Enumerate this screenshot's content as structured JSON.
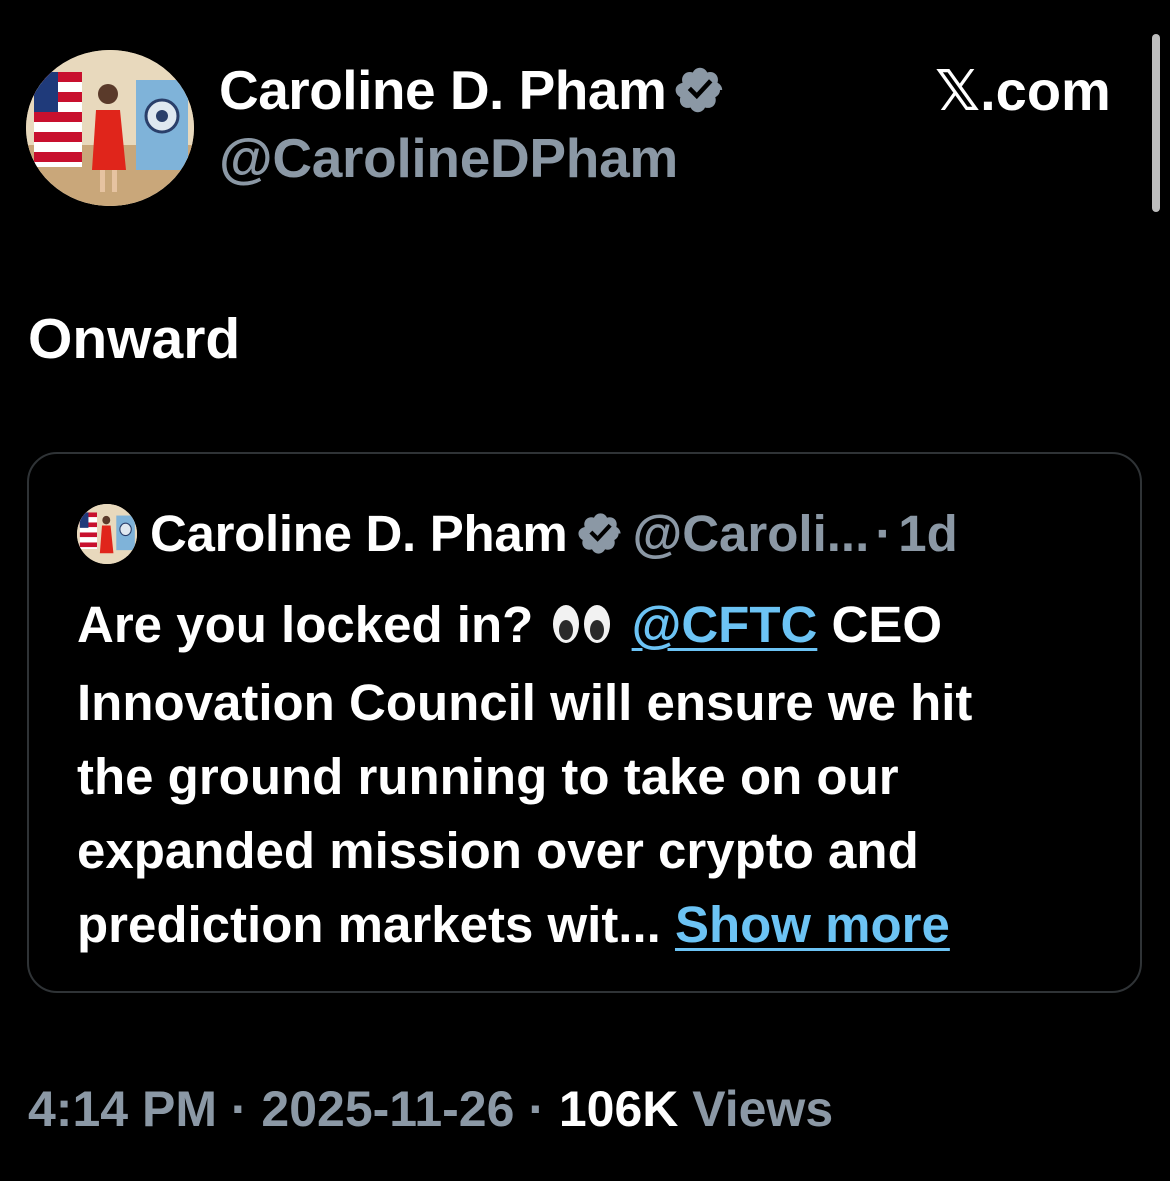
{
  "author": {
    "name": "Caroline D. Pham",
    "handle": "@CarolineDPham",
    "verified": true
  },
  "source_label": "𝕏.com",
  "tweet": {
    "text": "Onward"
  },
  "quote": {
    "name": "Caroline D. Pham",
    "handle": "@Caroli...",
    "separator": "·",
    "time": "1d",
    "lines": {
      "l1_pre": "Are you locked in?",
      "l1_emoji": "👀",
      "mention": "@CFTC",
      "l1_post": " CEO",
      "l2": "Innovation Council will ensure we hit",
      "l3": "the ground running to take on our",
      "l4": "expanded mission over crypto and",
      "l5_pre": "prediction markets wit... ",
      "show_more": "Show more"
    }
  },
  "meta": {
    "time": "4:14 PM",
    "sep1": " · ",
    "date": "2025-11-26",
    "sep2": " · ",
    "views_count": "106K",
    "views_label": " Views"
  },
  "colors": {
    "background": "#000000",
    "text": "#ffffff",
    "muted": "#8b98a5",
    "link": "#6cc3f4",
    "verified_badge": "#8b98a5",
    "card_border": "#2f3336"
  }
}
